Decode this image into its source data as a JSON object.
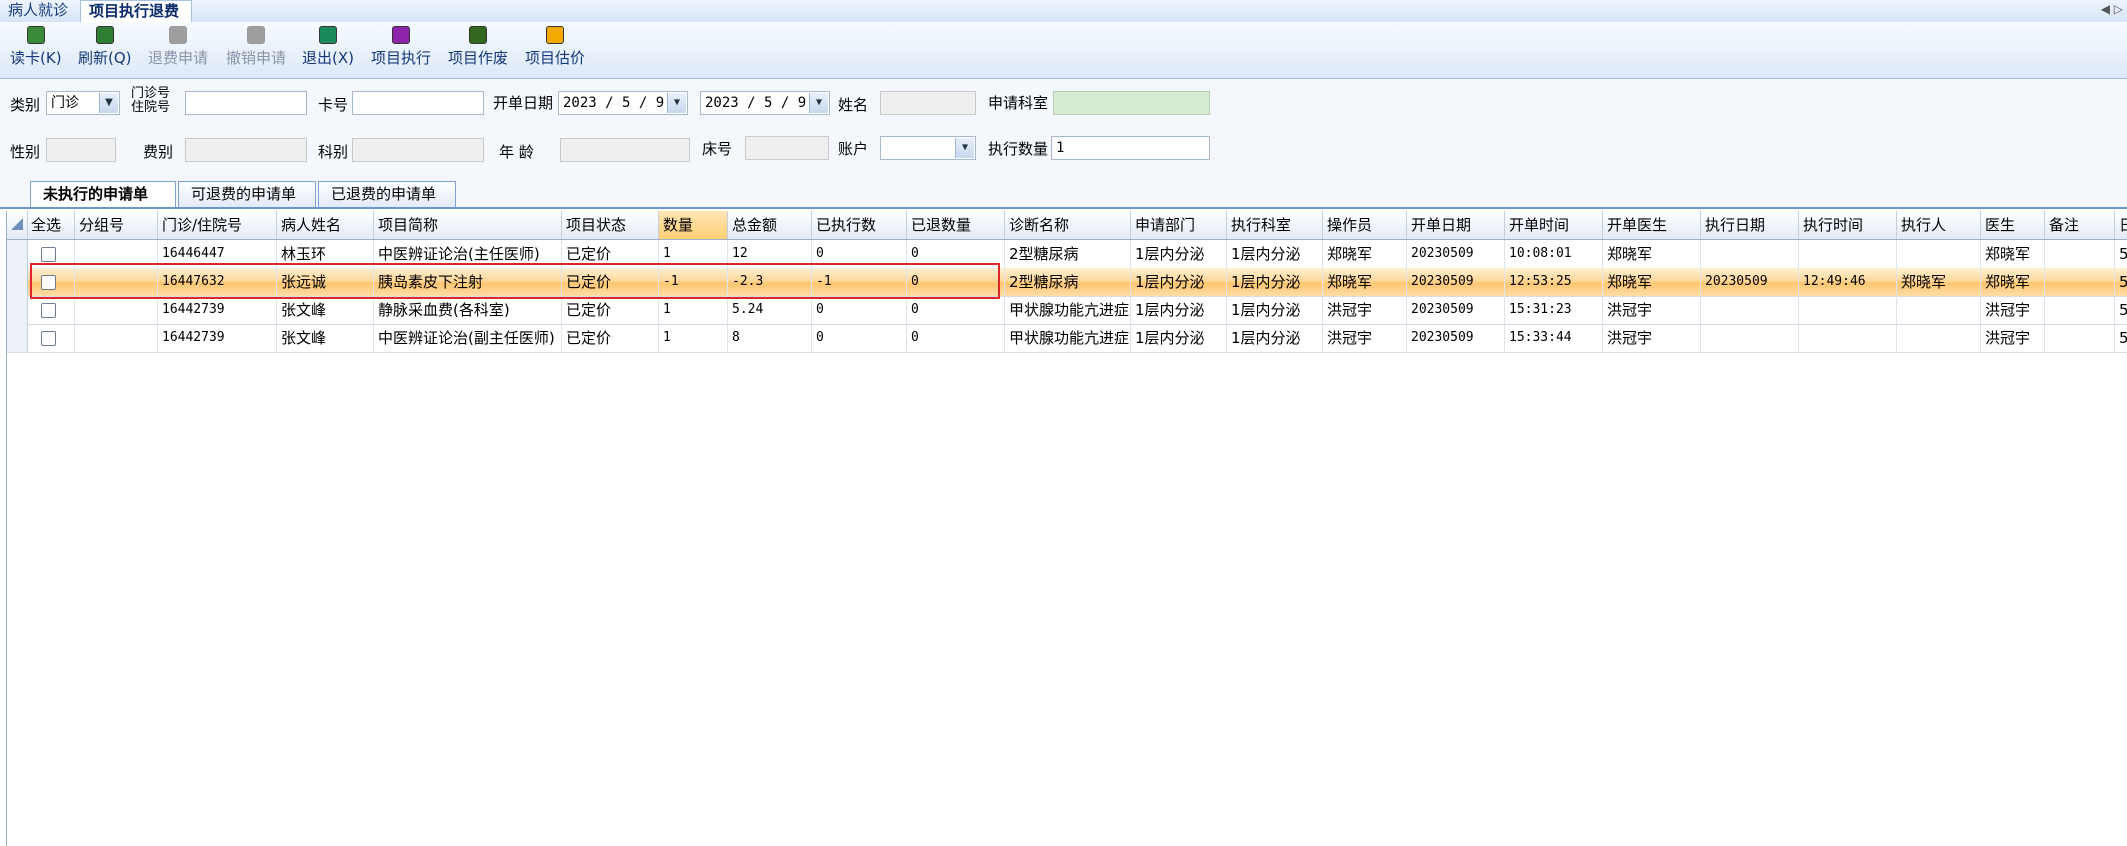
{
  "top_tabs": [
    "病人就诊",
    "项目执行退费"
  ],
  "nav_arrows": "◀ ▷",
  "toolbar": [
    {
      "label": "读卡(K)",
      "icon": "read-card-icon",
      "color": "#3a8a3a",
      "disabled": false
    },
    {
      "label": "刷新(Q)",
      "icon": "refresh-icon",
      "color": "#2e7d32",
      "disabled": false
    },
    {
      "label": "退费申请",
      "icon": "refund-request-icon",
      "color": "#9e9e9e",
      "disabled": true
    },
    {
      "label": "撤销申请",
      "icon": "revoke-request-icon",
      "color": "#9e9e9e",
      "disabled": true
    },
    {
      "label": "退出(X)",
      "icon": "exit-icon",
      "color": "#1b8a5a",
      "disabled": false
    },
    {
      "label": "项目执行",
      "icon": "execute-item-icon",
      "color": "#8e24aa",
      "disabled": false
    },
    {
      "label": "项目作废",
      "icon": "void-item-icon",
      "color": "#33691e",
      "disabled": false
    },
    {
      "label": "项目估价",
      "icon": "estimate-item-icon",
      "color": "#f2a900",
      "disabled": false
    }
  ],
  "filter": {
    "category_label": "类别",
    "category_value": "门诊",
    "outpatient_label_1": "门诊号",
    "outpatient_label_2": "住院号",
    "outpatient_value": "",
    "card_label": "卡号",
    "card_value": "",
    "order_date_label": "开单日期",
    "date_from": "2023 / 5 / 9",
    "date_to": "2023 / 5 / 9",
    "name_label": "姓名",
    "name_value": "",
    "apply_dept_label": "申请科室",
    "apply_dept_value": "",
    "gender_label": "性别",
    "gender_value": "",
    "fee_type_label": "费别",
    "fee_type_value": "",
    "dept_label": "科别",
    "dept_value": "",
    "age_label": "年  龄",
    "age_value": "",
    "bed_label": "床号",
    "bed_value": "",
    "account_label": "账户",
    "account_value": "",
    "exec_qty_label": "执行数量",
    "exec_qty_value": "1"
  },
  "sub_tabs": [
    "未执行的申请单",
    "可退费的申请单",
    "已退费的申请单"
  ],
  "grid": {
    "columns": [
      "全选",
      "分组号",
      "门诊/住院号",
      "病人姓名",
      "项目简称",
      "项目状态",
      "数量",
      "总金额",
      "已执行数",
      "已退数量",
      "诊断名称",
      "申请部门",
      "执行科室",
      "操作员",
      "开单日期",
      "开单时间",
      "开单医生",
      "执行日期",
      "执行时间",
      "执行人",
      "医生",
      "备注",
      "日"
    ],
    "highlighted_column": "数量",
    "selected_row_index": 1,
    "rows": [
      [
        "",
        "",
        "16446447",
        "林玉环",
        "中医辨证论治(主任医师)",
        "已定价",
        "1",
        "12",
        "0",
        "0",
        "2型糖尿病",
        "1层内分泌",
        "1层内分泌",
        "郑晓军",
        "20230509",
        "10:08:01",
        "郑晓军",
        "",
        "",
        "",
        "郑晓军",
        "",
        "5"
      ],
      [
        "",
        "",
        "16447632",
        "张远诚",
        "胰岛素皮下注射",
        "已定价",
        "-1",
        "-2.3",
        "-1",
        "0",
        "2型糖尿病",
        "1层内分泌",
        "1层内分泌",
        "郑晓军",
        "20230509",
        "12:53:25",
        "郑晓军",
        "20230509",
        "12:49:46",
        "郑晓军",
        "郑晓军",
        "",
        "5"
      ],
      [
        "",
        "",
        "16442739",
        "张文峰",
        "静脉采血费(各科室)",
        "已定价",
        "1",
        "5.24",
        "0",
        "0",
        "甲状腺功能亢进症",
        "1层内分泌",
        "1层内分泌",
        "洪冠宇",
        "20230509",
        "15:31:23",
        "洪冠宇",
        "",
        "",
        "",
        "洪冠宇",
        "",
        "5"
      ],
      [
        "",
        "",
        "16442739",
        "张文峰",
        "中医辨证论治(副主任医师)",
        "已定价",
        "1",
        "8",
        "0",
        "0",
        "甲状腺功能亢进症",
        "1层内分泌",
        "1层内分泌",
        "洪冠宇",
        "20230509",
        "15:33:44",
        "洪冠宇",
        "",
        "",
        "",
        "洪冠宇",
        "",
        "5"
      ]
    ]
  }
}
